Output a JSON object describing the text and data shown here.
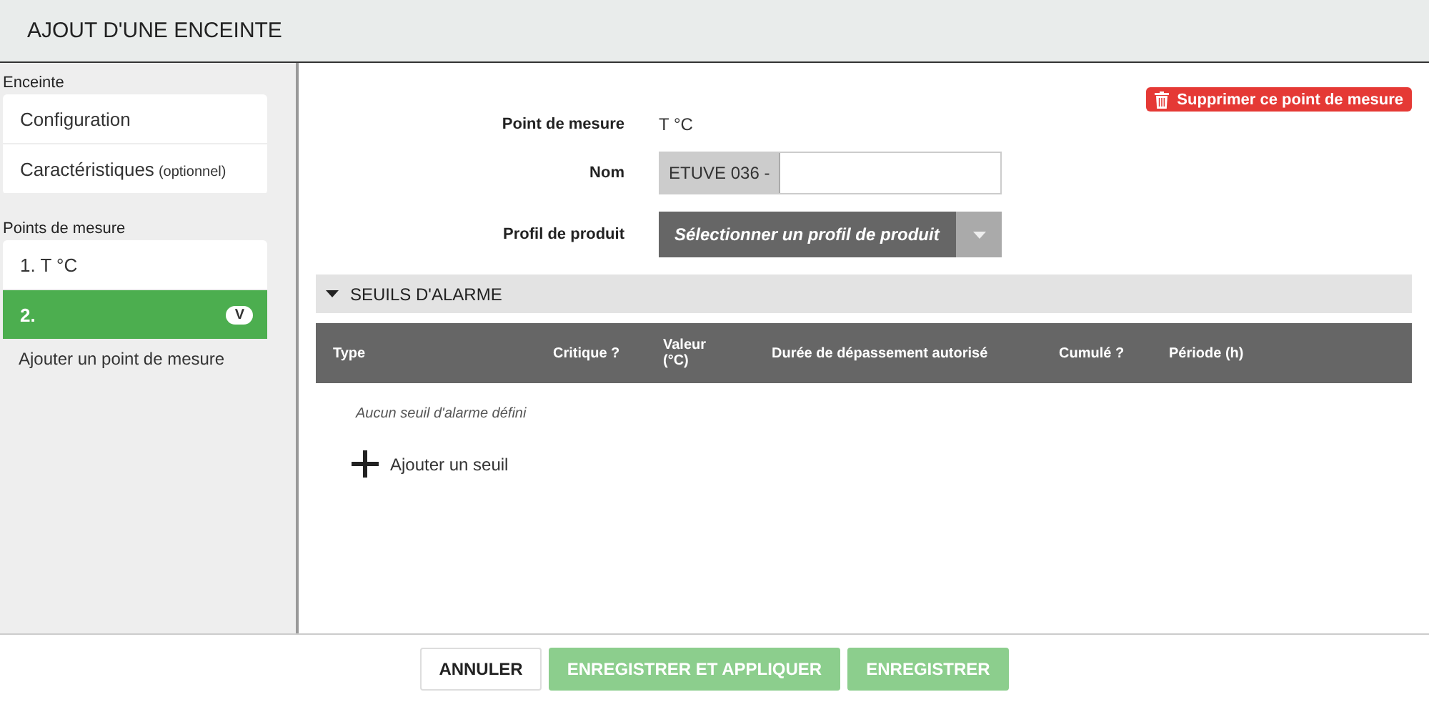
{
  "window": {
    "title": "AJOUT D'UNE ENCEINTE"
  },
  "sidebar": {
    "sections": [
      {
        "title": "Enceinte",
        "items": [
          {
            "label": "Configuration",
            "selected": false
          },
          {
            "label": "Caractéristiques",
            "note": "(optionnel)",
            "selected": false
          }
        ]
      },
      {
        "title": "Points de mesure",
        "items": [
          {
            "label": "1. T °C",
            "selected": false
          },
          {
            "label": "2.",
            "badge": "V",
            "selected": true
          }
        ],
        "add_link": "Ajouter un point de mesure"
      }
    ]
  },
  "delete_button": "Supprimer ce point de mesure",
  "form": [
    {
      "kind": "text",
      "label": "Point de mesure",
      "value": "T °C"
    },
    {
      "kind": "prefixed",
      "label": "Nom",
      "prefix": "ETUVE 036 -"
    },
    {
      "kind": "select",
      "label": "Profil de produit",
      "placeholder": "Sélectionner un profil de produit"
    }
  ],
  "alarm_section": {
    "title": "SEUILS D'ALARME",
    "expanded": true,
    "columns": [
      "Type",
      "Critique ?",
      "Valeur (°C)",
      "Durée de dépassement autorisé",
      "Cumulé ?",
      "Période (h)"
    ],
    "empty_text": "Aucun seuil d'alarme défini",
    "add_label": "Ajouter un seuil"
  },
  "footer_buttons": [
    {
      "label": "ANNULER",
      "kind": "secondary",
      "disabled": false
    },
    {
      "label": "ENREGISTRER ET APPLIQUER",
      "kind": "primary",
      "disabled": true
    },
    {
      "label": "ENREGISTRER",
      "kind": "primary",
      "disabled": true
    }
  ]
}
